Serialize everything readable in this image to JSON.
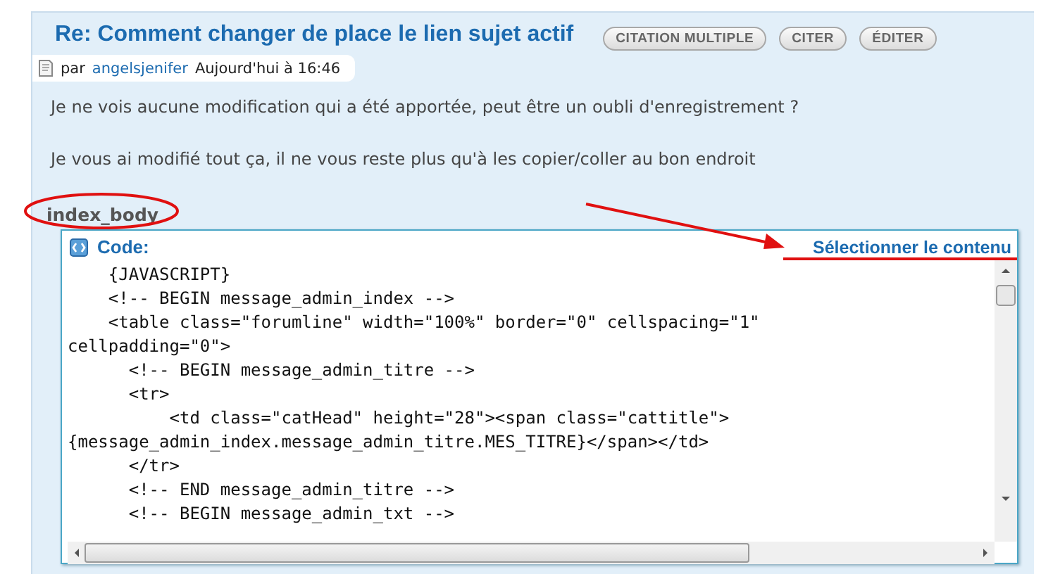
{
  "post": {
    "title": "Re: Comment changer de place le lien sujet actif",
    "buttons": [
      "CITATION MULTIPLE",
      "CITER",
      "ÉDITER"
    ],
    "meta": {
      "prefix": "par",
      "author": "angelsjenifer",
      "date": "Aujourd'hui à 16:46"
    },
    "paragraphs": [
      "Je ne vois aucune modification qui a été apportée, peut être un oubli d'enregistrement ?",
      "Je vous ai modifié tout ça, il ne vous reste plus qu'à les copier/coller au bon endroit"
    ],
    "section_label": "index_body",
    "code": {
      "label": "Code:",
      "select_link": "Sélectionner le contenu",
      "lines": [
        "    {JAVASCRIPT}",
        "    <!-- BEGIN message_admin_index -->",
        "    <table class=\"forumline\" width=\"100%\" border=\"0\" cellspacing=\"1\"",
        "cellpadding=\"0\">",
        "      <!-- BEGIN message_admin_titre -->",
        "      <tr>",
        "          <td class=\"catHead\" height=\"28\"><span class=\"cattitle\">",
        "{message_admin_index.message_admin_titre.MES_TITRE}</span></td>",
        "      </tr>",
        "      <!-- END message_admin_titre -->",
        "      <!-- BEGIN message_admin_txt -->"
      ]
    }
  }
}
